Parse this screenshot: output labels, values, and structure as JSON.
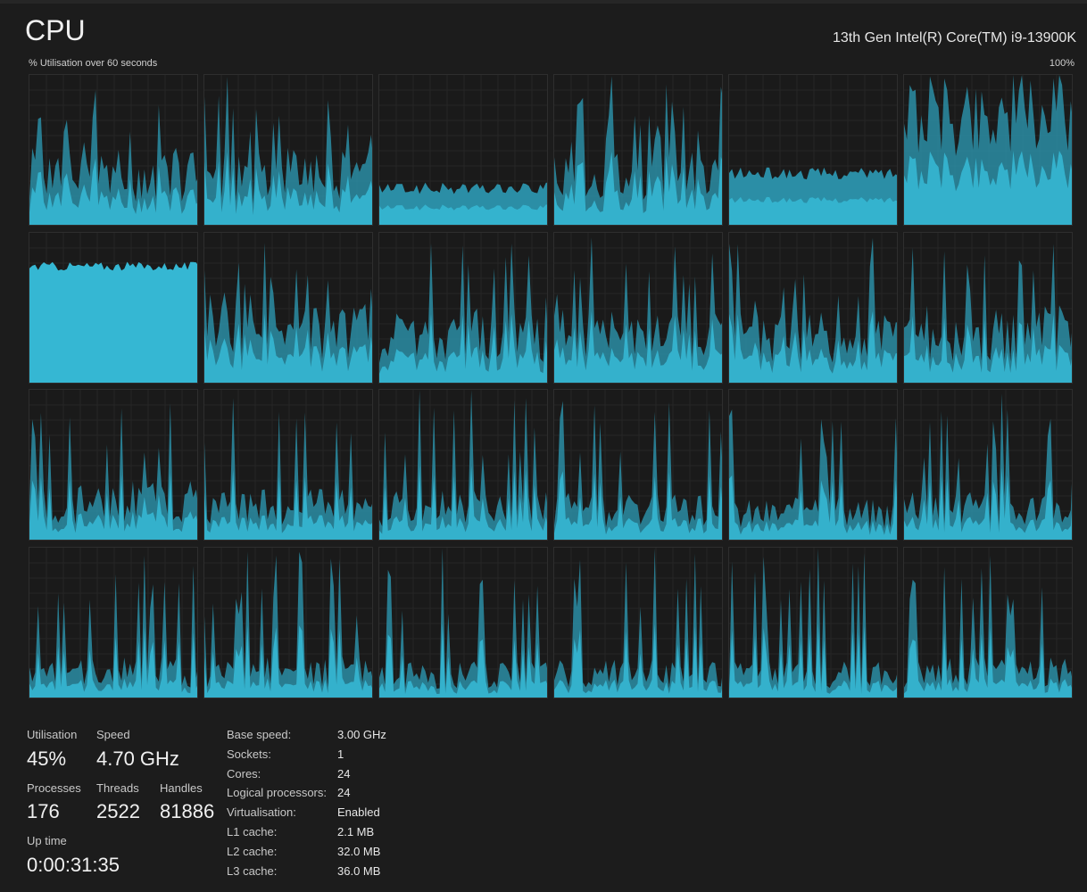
{
  "header": {
    "title": "CPU",
    "model": "13th Gen Intel(R) Core(TM) i9-13900K",
    "graph_caption": "% Utilisation over 60 seconds",
    "graph_max": "100%"
  },
  "colors": {
    "accent": "#35b7d3",
    "accent_dark": "#2b8ea6",
    "background": "#1c1c1c",
    "grid_line": "#2e2e2e"
  },
  "chart_data": {
    "type": "area",
    "series": [
      {
        "profile": "spiky",
        "avg": 0.45
      },
      {
        "profile": "spiky",
        "avg": 0.42
      },
      {
        "profile": "flat",
        "avg": 0.25
      },
      {
        "profile": "spiky",
        "avg": 0.48
      },
      {
        "profile": "flat",
        "avg": 0.35
      },
      {
        "profile": "high",
        "avg": 0.65
      },
      {
        "profile": "full",
        "avg": 0.78
      },
      {
        "profile": "spiky",
        "avg": 0.45
      },
      {
        "profile": "spiky",
        "avg": 0.4
      },
      {
        "profile": "spiky",
        "avg": 0.4
      },
      {
        "profile": "spiky",
        "avg": 0.38
      },
      {
        "profile": "spiky",
        "avg": 0.42
      },
      {
        "profile": "spiky",
        "avg": 0.32
      },
      {
        "profile": "spiky",
        "avg": 0.28
      },
      {
        "profile": "spiky",
        "avg": 0.27
      },
      {
        "profile": "spiky",
        "avg": 0.26
      },
      {
        "profile": "spiky",
        "avg": 0.24
      },
      {
        "profile": "spiky",
        "avg": 0.26
      },
      {
        "profile": "spiky",
        "avg": 0.22
      },
      {
        "profile": "spiky",
        "avg": 0.23
      },
      {
        "profile": "spiky",
        "avg": 0.2
      },
      {
        "profile": "spiky",
        "avg": 0.21
      },
      {
        "profile": "spiky",
        "avg": 0.2
      },
      {
        "profile": "spiky",
        "avg": 0.22
      }
    ]
  },
  "stats": {
    "utilisation": {
      "label": "Utilisation",
      "value": "45%"
    },
    "speed": {
      "label": "Speed",
      "value": "4.70 GHz"
    },
    "processes": {
      "label": "Processes",
      "value": "176"
    },
    "threads": {
      "label": "Threads",
      "value": "2522"
    },
    "handles": {
      "label": "Handles",
      "value": "81886"
    },
    "uptime": {
      "label": "Up time",
      "value": "0:00:31:35"
    }
  },
  "specs": [
    {
      "key": "Base speed:",
      "value": "3.00 GHz"
    },
    {
      "key": "Sockets:",
      "value": "1"
    },
    {
      "key": "Cores:",
      "value": "24"
    },
    {
      "key": "Logical processors:",
      "value": "24"
    },
    {
      "key": "Virtualisation:",
      "value": "Enabled"
    },
    {
      "key": "L1 cache:",
      "value": "2.1 MB"
    },
    {
      "key": "L2 cache:",
      "value": "32.0 MB"
    },
    {
      "key": "L3 cache:",
      "value": "36.0 MB"
    }
  ]
}
